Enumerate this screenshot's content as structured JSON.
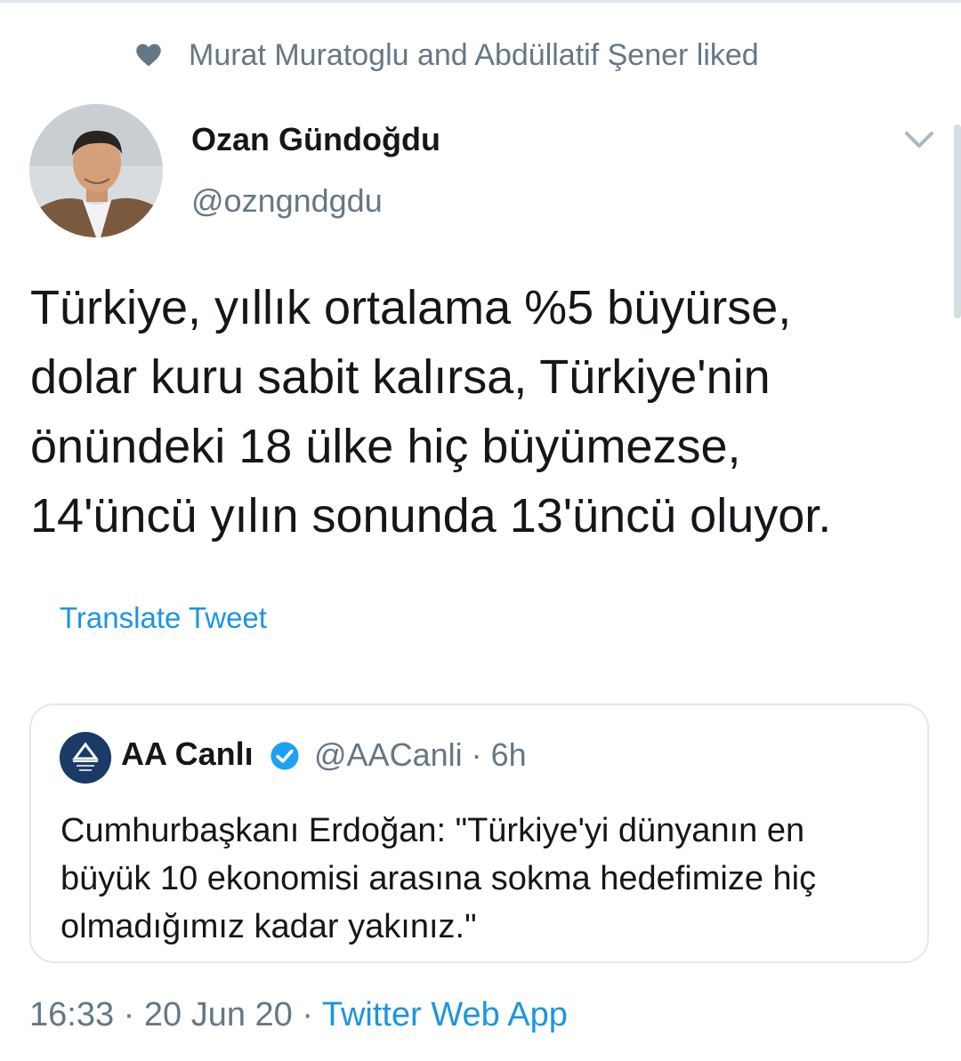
{
  "social_context": {
    "text": "Murat Muratoglu and Abdüllatif Şener liked",
    "icon": "heart-icon"
  },
  "author": {
    "name": "Ozan Gündoğdu",
    "handle": "@ozngndgdu"
  },
  "tweet": {
    "text": "Türkiye, yıllık ortalama %5 büyürse,\ndolar kuru sabit kalırsa, Türkiye'nin\nönündeki 18 ülke hiç büyümezse,\n14'üncü yılın sonunda 13'üncü oluyor.",
    "translate_label": "Translate Tweet"
  },
  "quoted": {
    "name": "AA Canlı",
    "verified": true,
    "handle_time": "@AACanli · 6h",
    "text": "Cumhurbaşkanı Erdoğan: \"Türkiye'yi dünyanın en\nbüyük 10 ekonomisi arasına sokma hedefimize hiç\nolmadığımız kadar yakınız.\""
  },
  "meta": {
    "timestamp": "16:33 · 20 Jun 20 · ",
    "source": "Twitter Web App"
  },
  "colors": {
    "link": "#1b95e0",
    "muted": "#657786",
    "text": "#14171a",
    "border": "#e1e8ed"
  }
}
